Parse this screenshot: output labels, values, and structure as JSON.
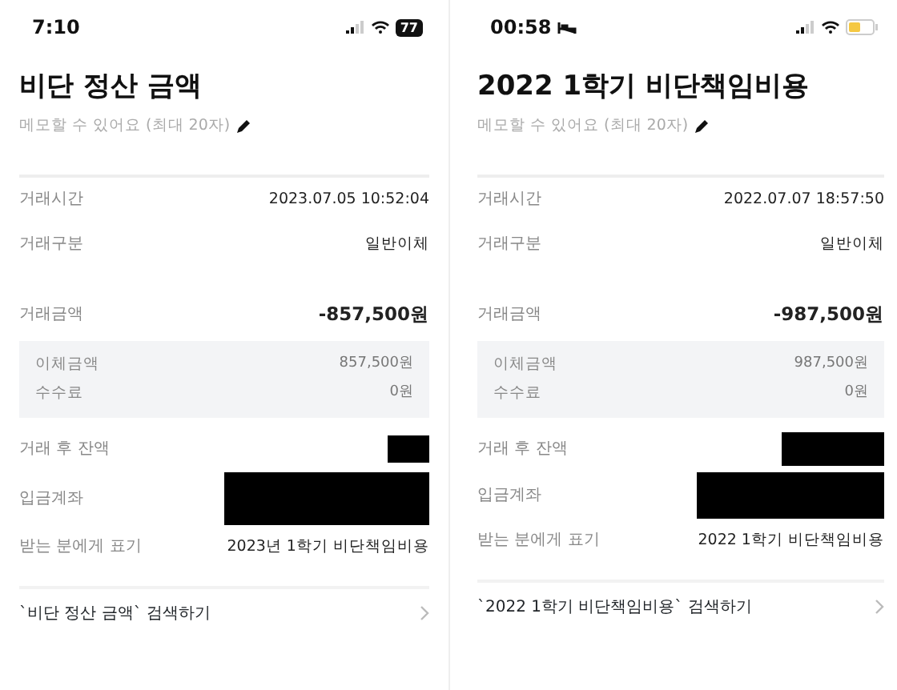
{
  "screens": [
    {
      "status_bar": {
        "time": "7:10",
        "sleep_focus": false,
        "battery_text": "77",
        "low_power": false
      },
      "title": "비단 정산 금액",
      "memo_placeholder": "메모할 수 있어요 (최대 20자)",
      "rows": [
        {
          "kind": "plain",
          "label": "거래시간",
          "value": "2023.07.05 10:52:04"
        },
        {
          "kind": "plain",
          "label": "거래구분",
          "value": "일반이체"
        },
        {
          "kind": "total",
          "label": "거래금액",
          "value": "-857,500원"
        },
        {
          "kind": "detail",
          "label": "이체금액",
          "value": "857,500원"
        },
        {
          "kind": "detail",
          "label": "수수료",
          "value": "0원"
        },
        {
          "kind": "redacted-small",
          "label": "거래 후 잔액"
        },
        {
          "kind": "redacted-large",
          "label": "입금계좌"
        },
        {
          "kind": "plain",
          "label": "받는 분에게 표기",
          "value": "2023년 1학기 비단책임비용"
        }
      ],
      "search_link": "`비단 정산 금액` 검색하기"
    },
    {
      "status_bar": {
        "time": "00:58",
        "sleep_focus": true,
        "low_power": true
      },
      "title": "2022 1학기 비단책임비용",
      "memo_placeholder": "메모할 수 있어요 (최대 20자)",
      "rows": [
        {
          "kind": "plain",
          "label": "거래시간",
          "value": "2022.07.07 18:57:50"
        },
        {
          "kind": "plain",
          "label": "거래구분",
          "value": "일반이체"
        },
        {
          "kind": "total",
          "label": "거래금액",
          "value": "-987,500원"
        },
        {
          "kind": "detail",
          "label": "이체금액",
          "value": "987,500원"
        },
        {
          "kind": "detail",
          "label": "수수료",
          "value": "0원"
        },
        {
          "kind": "redacted-small",
          "label": "거래 후 잔액"
        },
        {
          "kind": "redacted-large",
          "label": "입금계좌"
        },
        {
          "kind": "plain",
          "label": "받는 분에게 표기",
          "value": "2022 1학기 비단책임비용"
        }
      ],
      "search_link": "`2022 1학기 비단책임비용` 검색하기"
    }
  ]
}
